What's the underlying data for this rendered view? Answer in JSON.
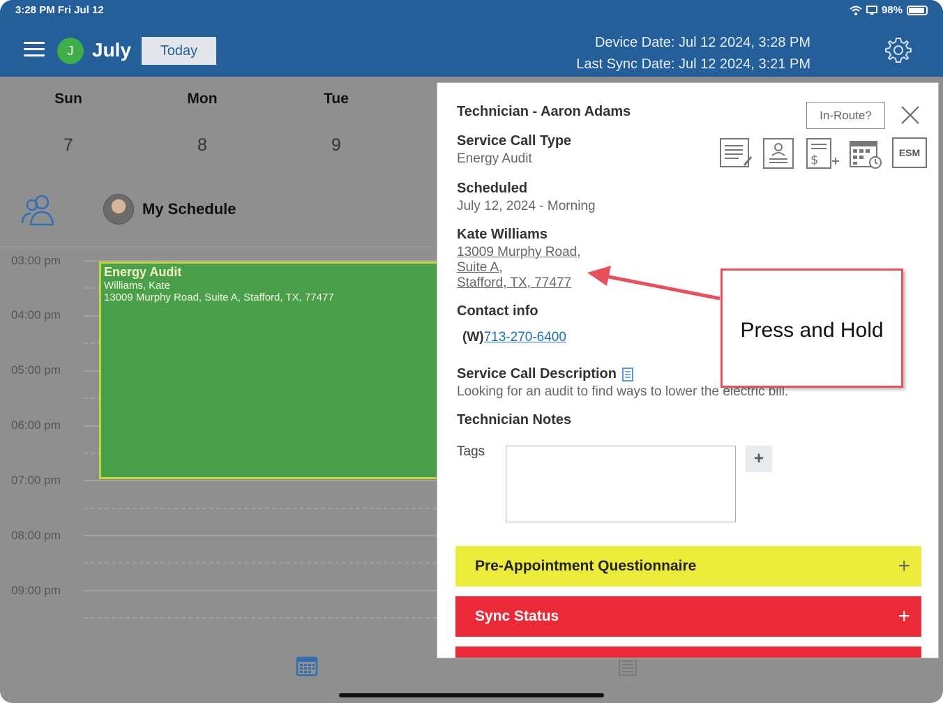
{
  "status_bar": {
    "time": "3:28 PM   Fri Jul 12",
    "battery": "98%"
  },
  "header": {
    "avatar_initial": "J",
    "month": "July",
    "today_label": "Today",
    "device_date": "Device Date: Jul 12 2024, 3:28 PM",
    "last_sync": "Last Sync Date: Jul 12 2024, 3:21 PM"
  },
  "calendar": {
    "days": [
      {
        "name": "Sun",
        "num": "7"
      },
      {
        "name": "Mon",
        "num": "8"
      },
      {
        "name": "Tue",
        "num": "9"
      }
    ],
    "schedule_label": "My Schedule",
    "times": [
      "03:00 pm",
      "04:00 pm",
      "05:00 pm",
      "06:00 pm",
      "07:00 pm",
      "08:00 pm",
      "09:00 pm"
    ],
    "event": {
      "title": "Energy Audit",
      "customer": "Williams, Kate",
      "address": "13009 Murphy Road, Suite A, Stafford, TX, 77477"
    }
  },
  "panel": {
    "technician": "Technician - Aaron Adams",
    "inroute_label": "In-Route?",
    "esm_label": "ESM",
    "service_call_type_label": "Service Call Type",
    "service_call_type": "Energy Audit",
    "scheduled_label": "Scheduled",
    "scheduled": "July 12, 2024 - Morning",
    "customer_name": "Kate Williams",
    "address_lines": [
      "13009 Murphy Road,",
      "Suite A,",
      "Stafford, TX, 77477"
    ],
    "contact_label": "Contact info",
    "phone_prefix": "(W)",
    "phone": "713-270-6400",
    "description_label": "Service Call Description",
    "description": "Looking for an audit to find ways to lower the electric bill.",
    "tech_notes_label": "Technician Notes",
    "tags_label": "Tags",
    "tags_add": "+",
    "sections": [
      {
        "label": "Pre-Appointment Questionnaire",
        "color": "#ecec3a"
      },
      {
        "label": "Sync Status",
        "color": "#ec2a37"
      }
    ]
  },
  "annotation": {
    "text": "Press and Hold"
  }
}
